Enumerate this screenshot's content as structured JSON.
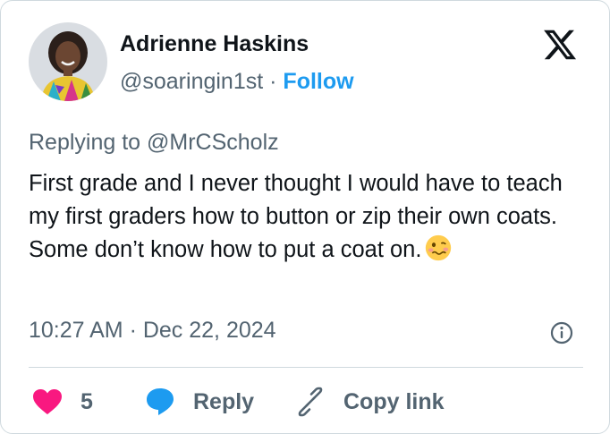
{
  "author": {
    "name": "Adrienne Haskins",
    "handle": "@soaringin1st",
    "separator": "·",
    "follow_label": "Follow"
  },
  "reply_context": "Replying to @MrCScholz",
  "tweet": {
    "text": "First grade and I never thought I would have to teach my first graders how to button or zip their own coats. Some don’t know how to put a coat on.",
    "emoji": "woozy-face",
    "timestamp": "10:27 AM · Dec 22, 2024"
  },
  "actions": {
    "like_count": "5",
    "reply_label": "Reply",
    "copy_link_label": "Copy link"
  },
  "colors": {
    "accent": "#1d9bf0",
    "like": "#f91880",
    "secondary_text": "#536471",
    "border": "#cfd9de"
  },
  "icons": [
    "x-logo-icon",
    "info-icon",
    "heart-icon",
    "reply-bubble-icon",
    "link-icon",
    "woozy-face-emoji"
  ]
}
